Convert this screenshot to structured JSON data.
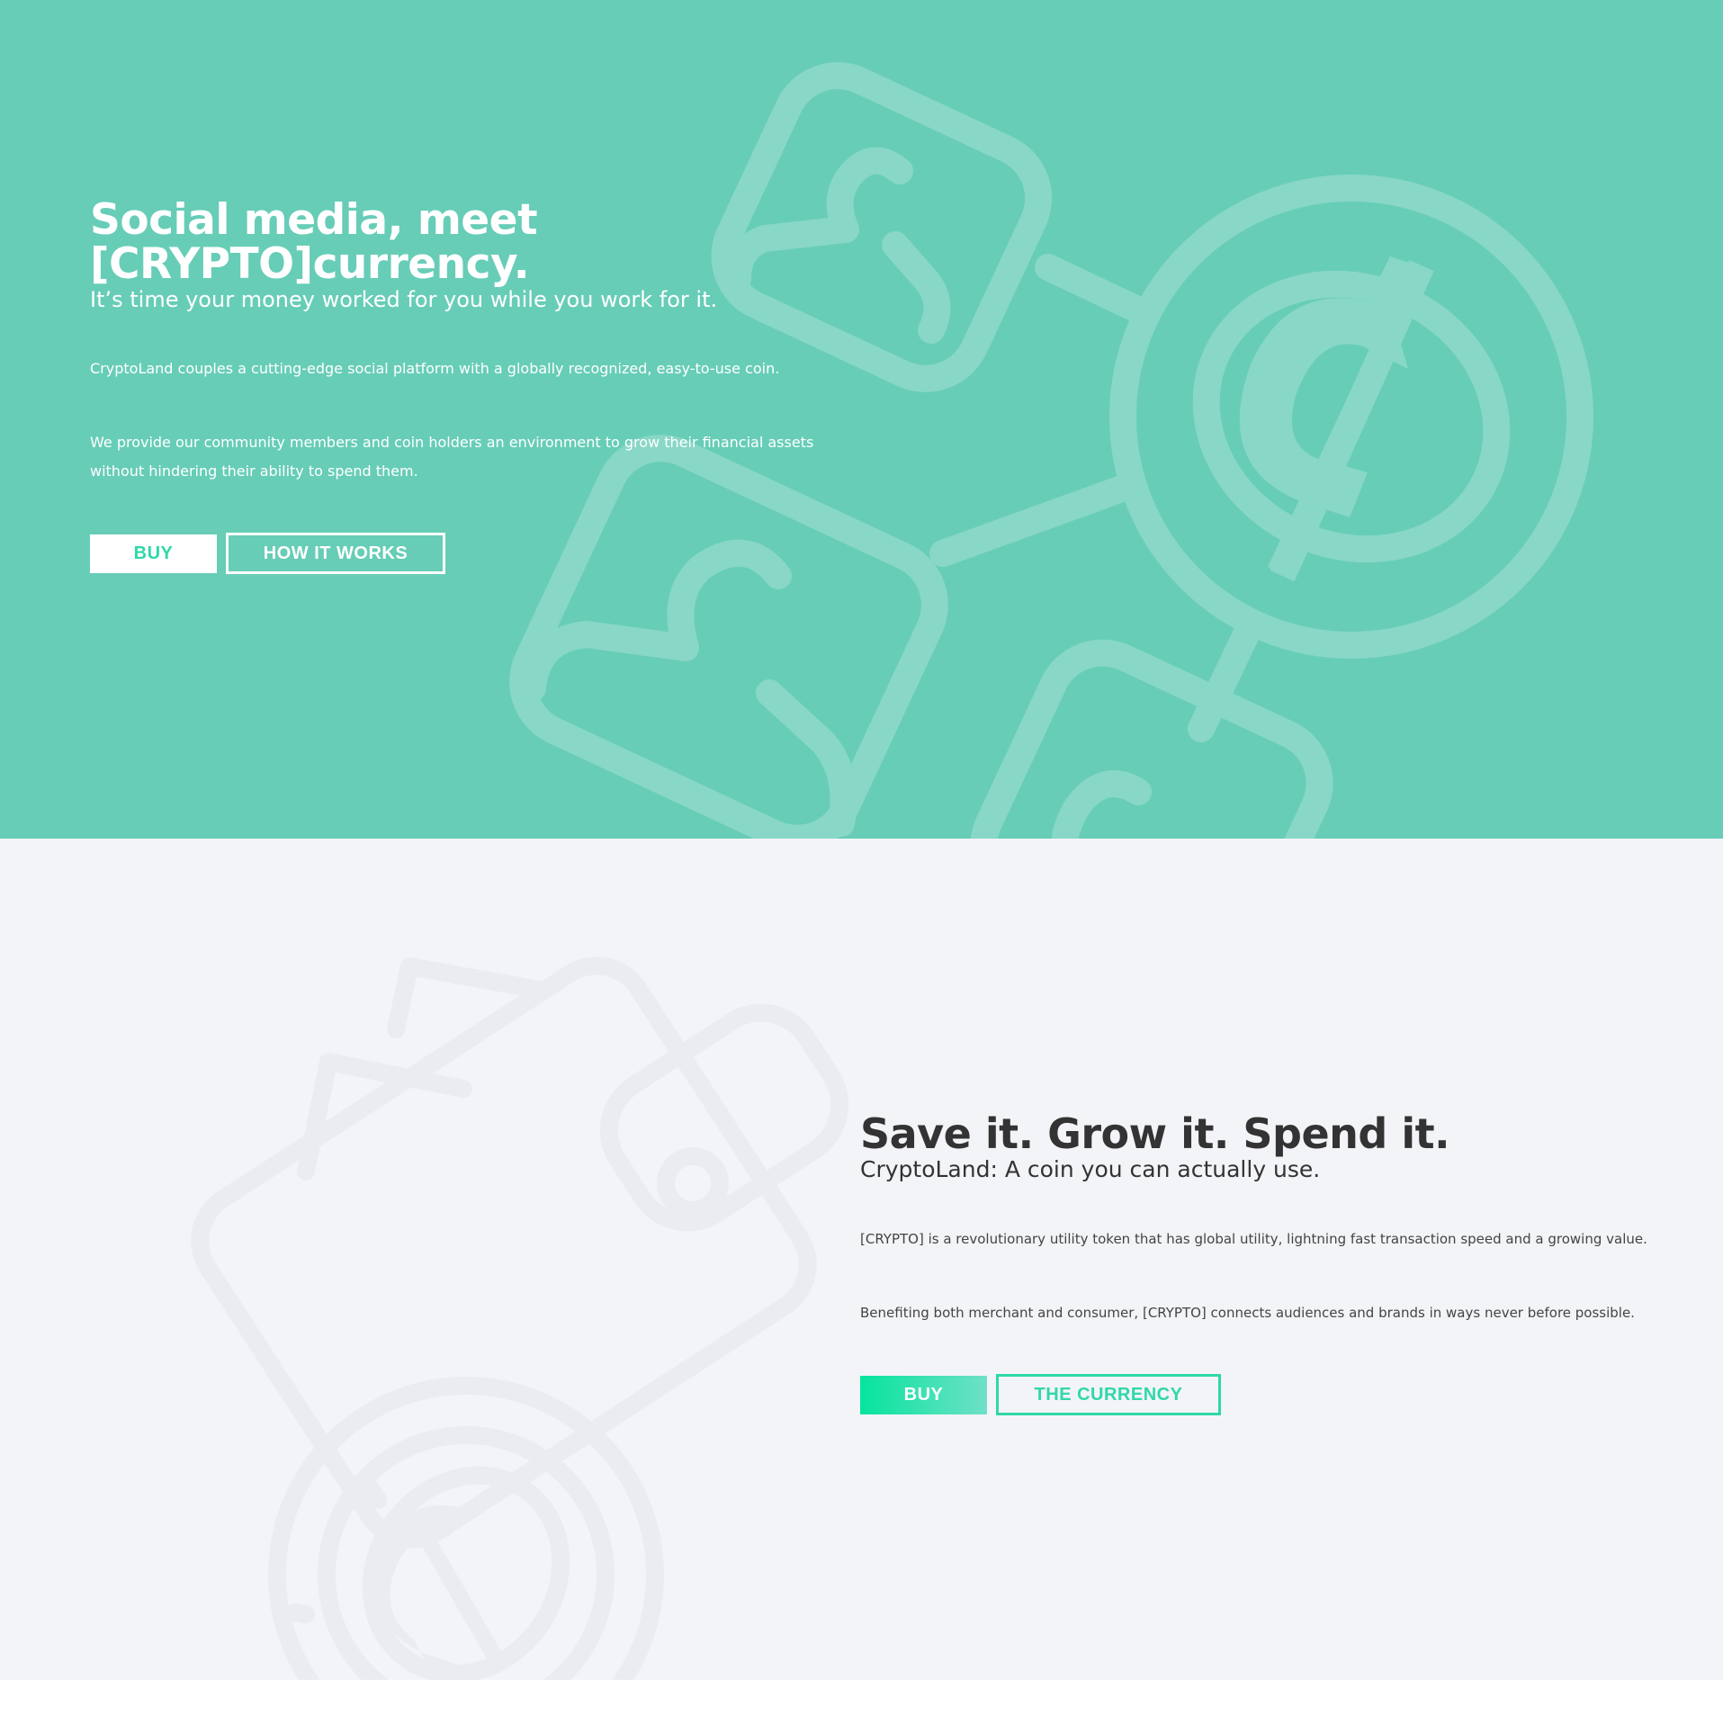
{
  "hero": {
    "title_line1": "Social media, meet",
    "title_line2": "[CRYPTO]currency.",
    "subtitle": "It’s time your money worked for you while you work for it.",
    "paragraph1": "CryptoLand couples a cutting-edge social platform with a globally recognized, easy-to-use coin.",
    "paragraph2": "We provide our community members and coin holders an environment to grow their financial assets without hindering their ability to spend them.",
    "buy_label": "BUY",
    "how_label": "HOW IT WORKS",
    "background_color": "#67cdb7",
    "illustration": "network-of-users-and-coin-icon"
  },
  "section2": {
    "title": "Save it. Grow it. Spend it.",
    "subtitle": "CryptoLand: A coin you can actually use.",
    "paragraph1": "[CRYPTO] is a revolutionary utility token that has global utility, lightning fast transaction speed and a growing value.",
    "paragraph2": "Benefiting both merchant and consumer, [CRYPTO] connects audiences and brands in ways never before possible.",
    "buy_label": "BUY",
    "currency_label": "THE CURRENCY",
    "background_color": "#f3f4f8",
    "accent_color": "#2fd8a9",
    "illustration": "wallet-with-coin-icon"
  }
}
